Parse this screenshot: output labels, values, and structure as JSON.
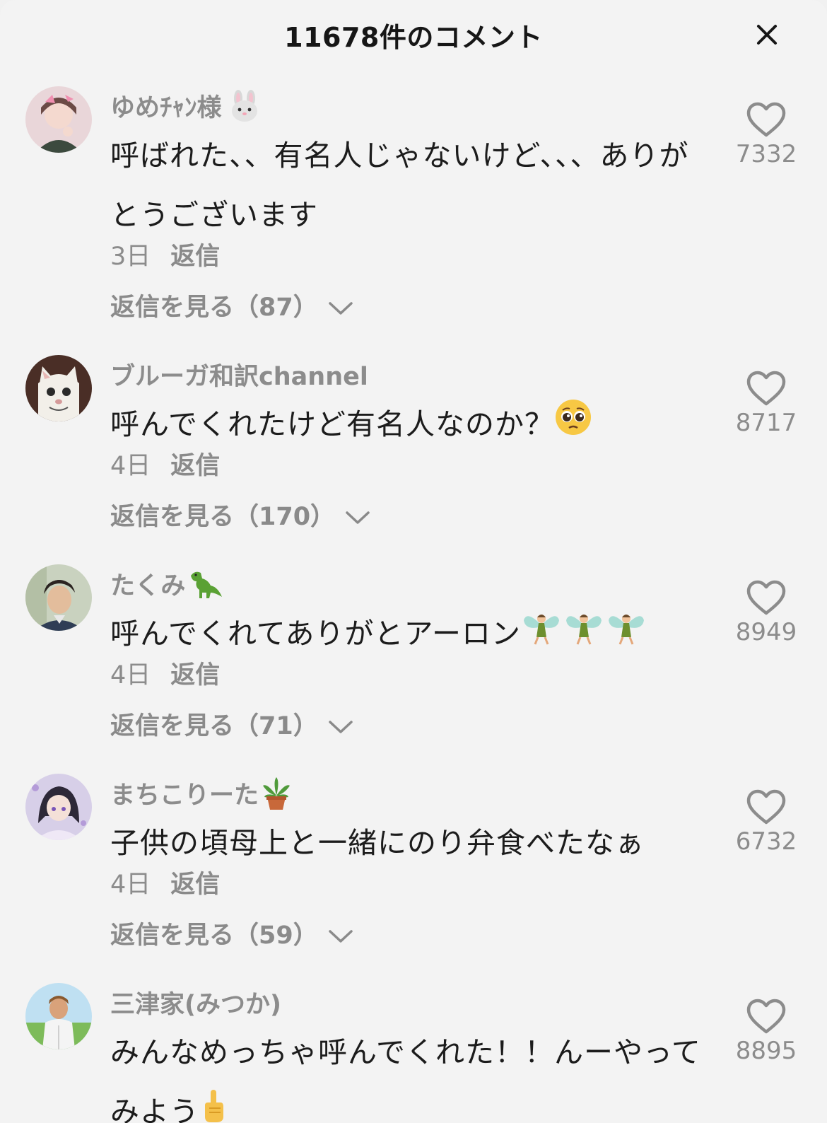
{
  "header": {
    "title": "11678件のコメント",
    "close_icon": "close-icon"
  },
  "comments": [
    {
      "username": "ゆめﾁｬﾝ様",
      "username_emoji": "rabbit-face-icon",
      "text": "呼ばれた、、有名人じゃないけど、、、ありがとうございます",
      "time": "3日",
      "reply_label": "返信",
      "view_replies": "返信を見る（87）",
      "likes": "7332"
    },
    {
      "username": "ブルーガ和訳channel",
      "text": "呼んでくれたけど有名人なのか？",
      "text_emoji": "pleading-face-icon",
      "time": "4日",
      "reply_label": "返信",
      "view_replies": "返信を見る（170）",
      "likes": "8717"
    },
    {
      "username": "たくみ",
      "username_emoji": "dinosaur-icon",
      "text": "呼んでくれてありがとアーロン",
      "text_emoji": "fairy-icon",
      "time": "4日",
      "reply_label": "返信",
      "view_replies": "返信を見る（71）",
      "likes": "8949"
    },
    {
      "username": "まちこりーた",
      "username_emoji": "potted-plant-icon",
      "text": "子供の頃母上と一緒にのり弁食べたなぁ",
      "time": "4日",
      "reply_label": "返信",
      "view_replies": "返信を見る（59）",
      "likes": "6732"
    },
    {
      "username": "三津家(みつか)",
      "text": "みんなめっちゃ呼んでくれた！！んーやってみよう",
      "text_emoji": "pointing-up-icon",
      "likes": "8895"
    }
  ],
  "colors": {
    "background": "#f3f3f3",
    "muted": "#8c8c8c",
    "text": "#1c1c1c"
  }
}
